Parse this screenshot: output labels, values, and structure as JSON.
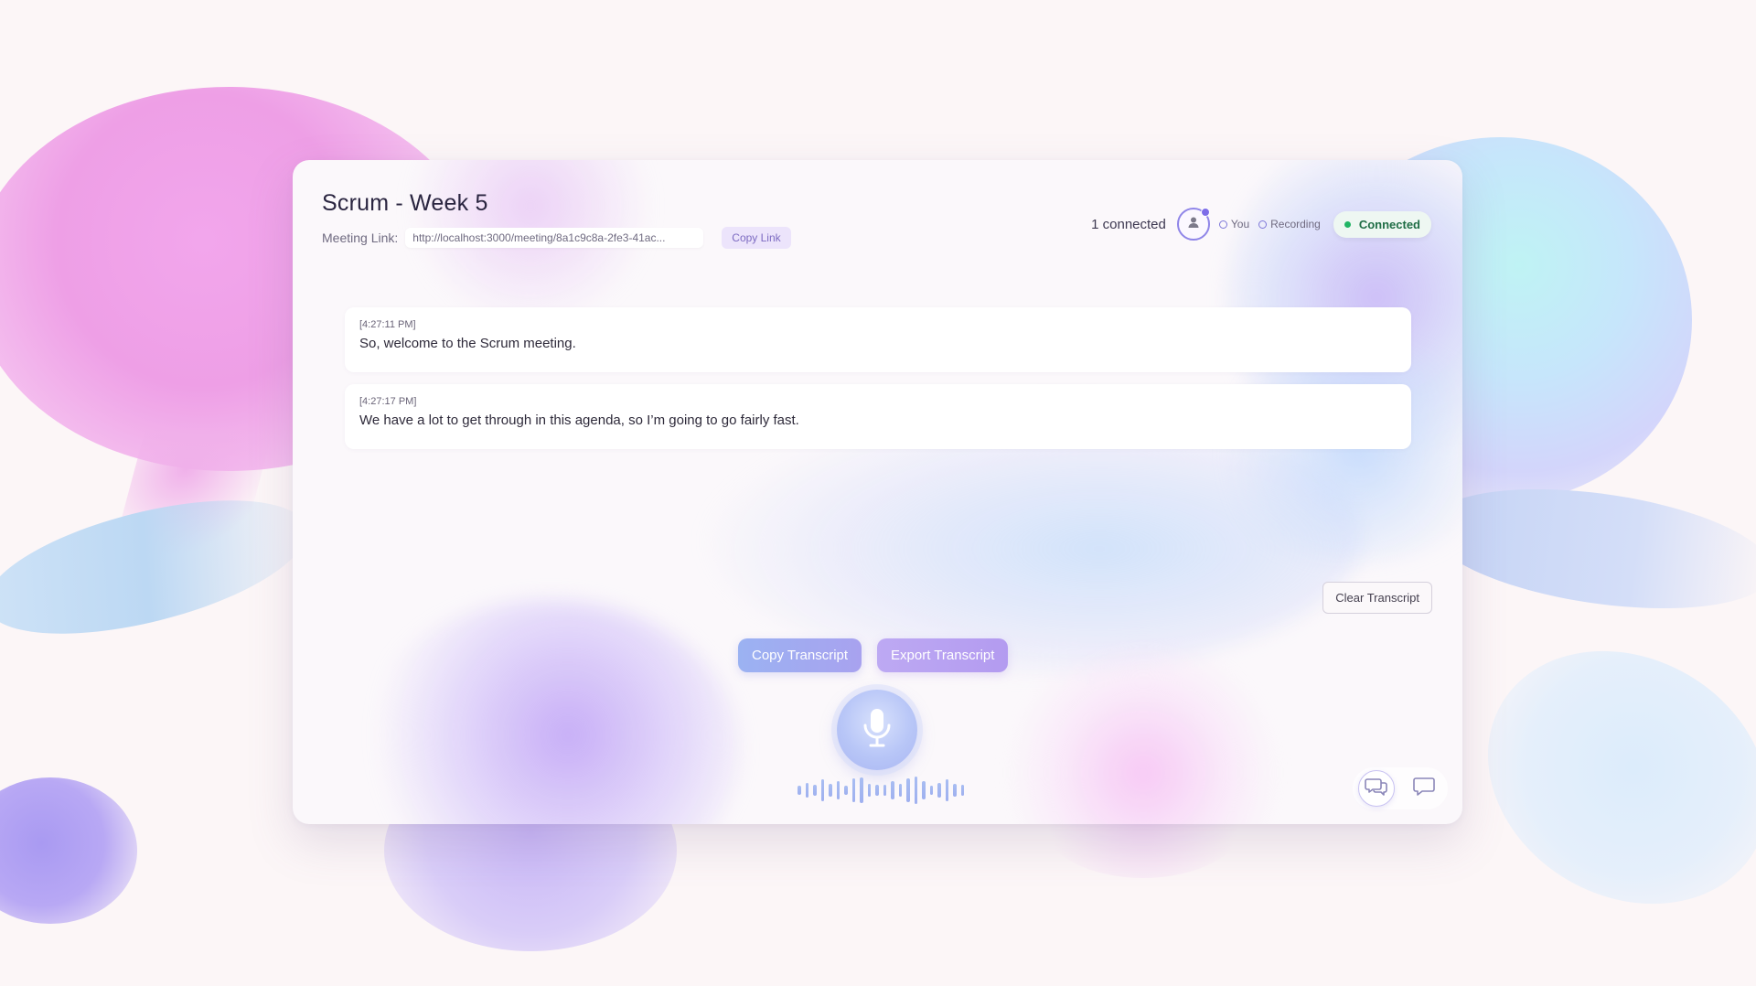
{
  "meeting": {
    "title": "Scrum - Week 5",
    "link_label": "Meeting Link:",
    "link_url": "http://localhost:3000/meeting/8a1c9c8a-2fe3-41ac...",
    "copy_link_label": "Copy Link"
  },
  "status": {
    "connected_count": "1 connected",
    "legend_you": "You",
    "legend_recording": "Recording",
    "badge": "Connected",
    "badge_color": "#22b565"
  },
  "transcript": [
    {
      "timestamp": "[4:27:11 PM]",
      "text": "So, welcome to the Scrum meeting."
    },
    {
      "timestamp": "[4:27:17 PM]",
      "text": "We have a lot to get through in this agenda, so I’m going to go fairly fast."
    }
  ],
  "actions": {
    "clear_label": "Clear Transcript",
    "copy_label": "Copy Transcript",
    "export_label": "Export Transcript"
  },
  "icons": {
    "avatar": "user-icon",
    "mic": "microphone-icon",
    "chat_active": "chat-bubbles-icon",
    "chat": "chat-bubble-icon"
  },
  "colors": {
    "accent": "#8f85e8",
    "copy_button": "#9bb2f2",
    "export_button": "#b39bf0"
  }
}
